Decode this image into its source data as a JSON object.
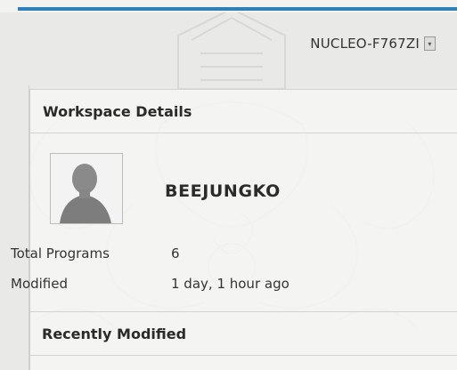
{
  "header": {
    "board_name": "NUCLEO-F767ZI"
  },
  "workspace": {
    "title": "Workspace Details",
    "username": "BEEJUNGKO",
    "stats": [
      {
        "label": "Total Programs",
        "value": "6"
      },
      {
        "label": "Modified",
        "value": "1 day, 1 hour ago"
      }
    ]
  },
  "recent": {
    "title": "Recently Modified"
  },
  "icons": {
    "board_dropdown": "chevron-down-icon",
    "avatar": "user-silhouette-icon"
  }
}
